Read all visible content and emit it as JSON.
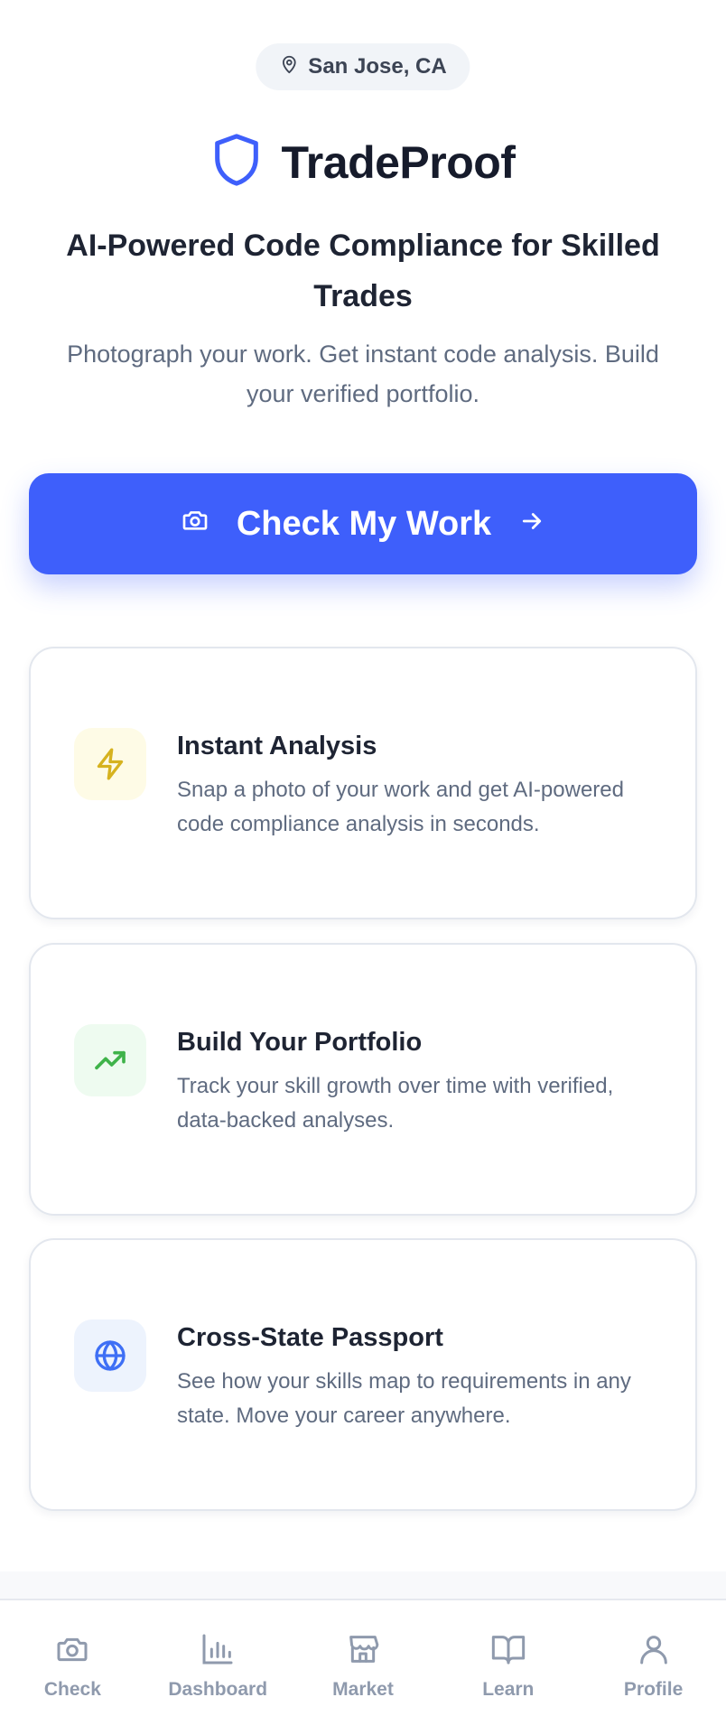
{
  "location": {
    "icon": "map-pin-icon",
    "label": "San Jose, CA"
  },
  "brand": {
    "icon": "shield-icon",
    "name": "TradeProof",
    "color": "#3e5ffb"
  },
  "hero": {
    "headline": "AI-Powered Code Compliance for Skilled Trades",
    "subheadline": "Photograph your work. Get instant code analysis. Build your verified portfolio."
  },
  "cta": {
    "label": "Check My Work",
    "icon": "camera-icon",
    "trailing_icon": "arrow-right-icon",
    "color": "#3e5ffb"
  },
  "features": [
    {
      "icon": "lightning-icon",
      "icon_color": "#d6b21f",
      "icon_bg": "#fefbe6",
      "title": "Instant Analysis",
      "description": "Snap a photo of your work and get AI-powered code compliance analysis in seconds."
    },
    {
      "icon": "trending-up-icon",
      "icon_color": "#3fb34a",
      "icon_bg": "#eefbf0",
      "title": "Build Your Portfolio",
      "description": "Track your skill growth over time with verified, data-backed analyses."
    },
    {
      "icon": "globe-icon",
      "icon_color": "#3e6ff5",
      "icon_bg": "#edf3fd",
      "title": "Cross-State Passport",
      "description": "See how your skills map to requirements in any state. Move your career anywhere."
    }
  ],
  "nav": {
    "items": [
      {
        "label": "Check",
        "icon": "camera-icon"
      },
      {
        "label": "Dashboard",
        "icon": "bar-chart-icon"
      },
      {
        "label": "Market",
        "icon": "storefront-icon"
      },
      {
        "label": "Learn",
        "icon": "book-open-icon"
      },
      {
        "label": "Profile",
        "icon": "user-icon"
      }
    ]
  }
}
